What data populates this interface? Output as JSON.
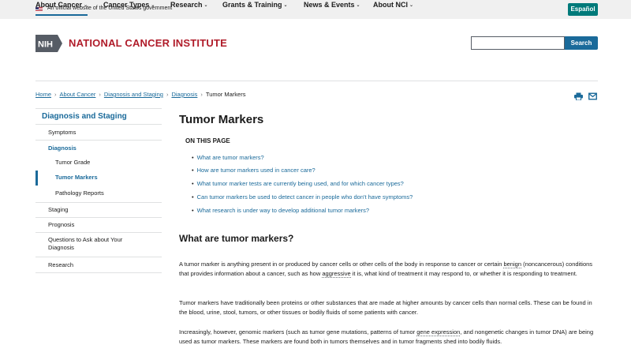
{
  "gov_banner": {
    "text": "An official website of the United States government"
  },
  "language_toggle": "Español",
  "logo": {
    "mark": "NIH",
    "name": "NATIONAL CANCER INSTITUTE"
  },
  "search": {
    "placeholder": "",
    "button": "Search"
  },
  "main_nav": [
    {
      "label": "About Cancer",
      "active": true
    },
    {
      "label": "Cancer Types",
      "active": false
    },
    {
      "label": "Research",
      "active": false
    },
    {
      "label": "Grants & Training",
      "active": false
    },
    {
      "label": "News & Events",
      "active": false
    },
    {
      "label": "About NCI",
      "active": false
    }
  ],
  "breadcrumb": [
    "Home",
    "About Cancer",
    "Diagnosis and Staging",
    "Diagnosis",
    "Tumor Markers"
  ],
  "side_nav": {
    "title": "Diagnosis and Staging",
    "items": [
      {
        "label": "Symptoms"
      },
      {
        "label": "Diagnosis"
      },
      {
        "label": "Tumor Grade"
      },
      {
        "label": "Tumor Markers"
      },
      {
        "label": "Pathology Reports"
      },
      {
        "label": "Staging"
      },
      {
        "label": "Prognosis"
      },
      {
        "label": "Questions to Ask about Your Diagnosis"
      },
      {
        "label": "Research"
      }
    ]
  },
  "page_title": "Tumor Markers",
  "on_this_page": {
    "heading": "ON THIS PAGE",
    "links": [
      "What are tumor markers?",
      "How are tumor markers used in cancer care?",
      "What tumor marker tests are currently being used, and for which cancer types?",
      "Can tumor markers be used to detect cancer in people who don't have symptoms?",
      "What research is under way to develop additional tumor markers?"
    ]
  },
  "section": {
    "heading": "What are tumor markers?",
    "p1": {
      "a": "A tumor marker is anything present in or produced by cancer cells or other cells of the body in response to cancer or certain ",
      "t1": "benign",
      "b": " (noncancerous) conditions that provides information about a cancer, such as how ",
      "t2": "aggressive",
      "c": " it is, what kind of treatment it may respond to, or whether it is responding to treatment."
    },
    "p2": "Tumor markers have traditionally been proteins or other substances that are made at higher amounts by cancer cells than normal cells. These can be found in the blood, urine, stool, tumors, or other tissues or bodily fluids of some patients with cancer.",
    "p3": {
      "a": "Increasingly, however, genomic markers (such as tumor gene mutations, patterns of tumor ",
      "t1": "gene expression",
      "b": ", and nongenetic changes in tumor DNA) are being used as tumor markers. These markers are found both in tumors themselves and in tumor fragments shed into bodily fluids."
    }
  },
  "colors": {
    "link": "#1a6a9a",
    "brand_red": "#b01c2a",
    "espanol_bg": "#007a7a"
  },
  "icons": [
    "us-flag-icon",
    "chevron-down-icon",
    "print-icon",
    "email-icon",
    "bullet-icon"
  ]
}
